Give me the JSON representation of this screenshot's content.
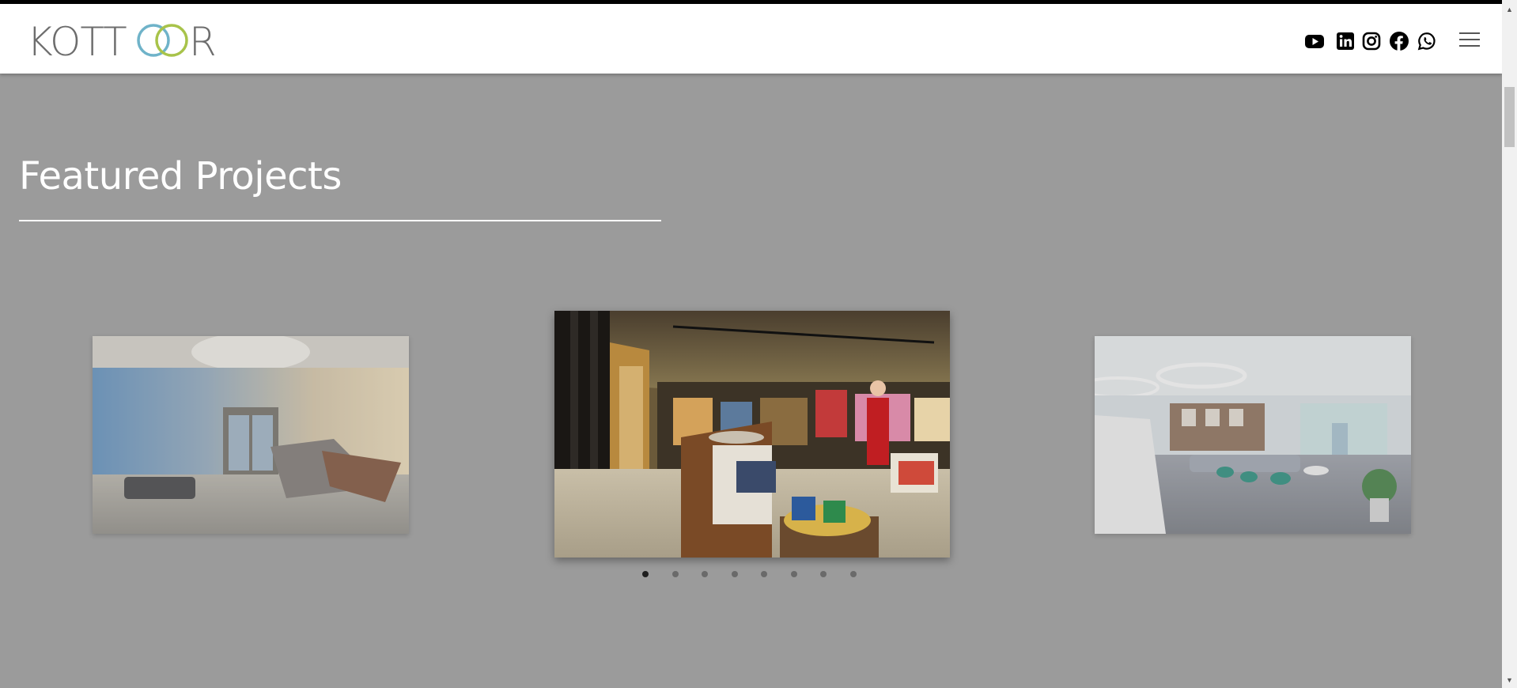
{
  "brand": {
    "logo_text": "KOTTOOR",
    "logo_colors": {
      "ring1": "#6fb3c9",
      "ring2": "#a8c34a",
      "text": "#6d6d6d"
    }
  },
  "social": [
    {
      "name": "YouTube",
      "icon": "youtube-icon"
    },
    {
      "name": "LinkedIn",
      "icon": "linkedin-icon"
    },
    {
      "name": "Instagram",
      "icon": "instagram-icon"
    },
    {
      "name": "Facebook",
      "icon": "facebook-icon"
    },
    {
      "name": "WhatsApp",
      "icon": "whatsapp-icon"
    }
  ],
  "menu": {
    "icon": "hamburger-menu-icon"
  },
  "featured": {
    "title": "Featured Projects",
    "slides_total": 8,
    "active_slide": 1
  },
  "colors": {
    "background": "#9b9b9b",
    "header": "#ffffff",
    "dot_active": "#1e1e1e",
    "dot_inactive": "#6a6a6a"
  }
}
